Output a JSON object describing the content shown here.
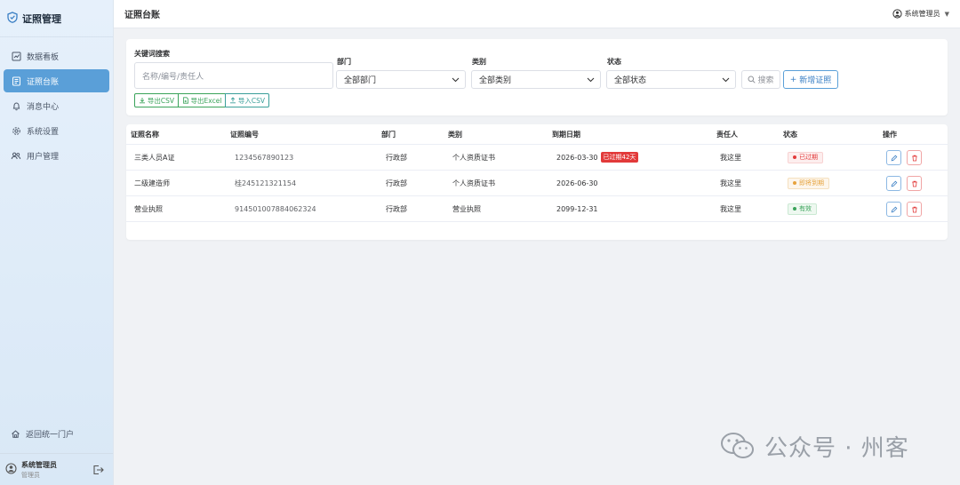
{
  "app": {
    "title": "证照管理"
  },
  "sidebar": {
    "items": [
      {
        "label": "数据看板",
        "icon": "dashboard-icon",
        "active": false
      },
      {
        "label": "证照台账",
        "icon": "ledger-icon",
        "active": true
      },
      {
        "label": "消息中心",
        "icon": "bell-icon",
        "active": false
      },
      {
        "label": "系统设置",
        "icon": "gear-icon",
        "active": false
      },
      {
        "label": "用户管理",
        "icon": "users-icon",
        "active": false
      }
    ],
    "portal_label": "返回统一门户",
    "user": {
      "name": "系统管理员",
      "role": "管理员"
    }
  },
  "header": {
    "title": "证照台账",
    "user_name": "系统管理员"
  },
  "filters": {
    "keyword_label": "关键词搜索",
    "keyword_placeholder": "名称/编号/责任人",
    "dept_label": "部门",
    "dept_value": "全部部门",
    "category_label": "类别",
    "category_value": "全部类别",
    "status_label": "状态",
    "status_value": "全部状态",
    "search_label": "搜索",
    "new_label": "新增证照",
    "export_csv": "导出CSV",
    "export_excel": "导出Excel",
    "import_csv": "导入CSV"
  },
  "table": {
    "columns": [
      "证照名称",
      "证照编号",
      "部门",
      "类别",
      "到期日期",
      "责任人",
      "状态",
      "操作"
    ],
    "rows": [
      {
        "name": "三类人员A证",
        "number": "1234567890123",
        "dept": "行政部",
        "category": "个人资质证书",
        "expiry": "2026-03-30",
        "overdue_tag": "已过期42天",
        "owner": "我这里",
        "status": "已过期",
        "status_color": "#e23a3a",
        "status_bg": "#fdeeee"
      },
      {
        "name": "二级建造师",
        "number": "桂245121321154",
        "dept": "行政部",
        "category": "个人资质证书",
        "expiry": "2026-06-30",
        "overdue_tag": "",
        "owner": "我这里",
        "status": "即将到期",
        "status_color": "#e6a23c",
        "status_bg": "#fdf6ec"
      },
      {
        "name": "营业执照",
        "number": "914501007884062324",
        "dept": "行政部",
        "category": "营业执照",
        "expiry": "2099-12-31",
        "overdue_tag": "",
        "owner": "我这里",
        "status": "有效",
        "status_color": "#3aa35a",
        "status_bg": "#eef8f0"
      }
    ]
  },
  "watermark": {
    "text": "公众号 · 州客",
    "icon": "wechat-icon"
  },
  "colors": {
    "accent": "#5a9fd8",
    "danger": "#e23a3a",
    "warning": "#e6a23c",
    "success": "#3aa35a",
    "export_green": "#3aa35a",
    "import_teal": "#3a9f9a"
  }
}
